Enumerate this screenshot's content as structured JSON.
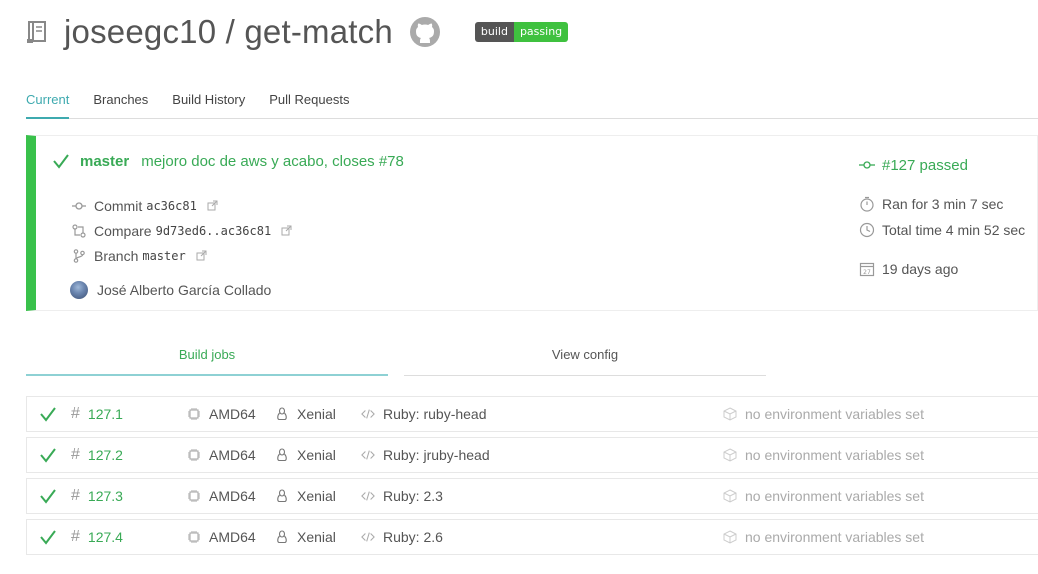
{
  "repo": {
    "owner": "joseegc10",
    "separator": " / ",
    "name": "get-match"
  },
  "badge": {
    "left": "build",
    "right": "passing"
  },
  "tabs": [
    {
      "label": "Current",
      "active": true
    },
    {
      "label": "Branches",
      "active": false
    },
    {
      "label": "Build History",
      "active": false
    },
    {
      "label": "Pull Requests",
      "active": false
    }
  ],
  "build": {
    "status": "passed",
    "branch": "master",
    "commit_message": "mejoro doc de aws y acabo, closes #78",
    "commit_label": "Commit",
    "commit_hash": "ac36c81",
    "compare_label": "Compare",
    "compare_range": "9d73ed6..ac36c81",
    "branch_label": "Branch",
    "branch_value": "master",
    "author": "José Alberto García Collado",
    "number_text": "#127 passed",
    "ran_for": "Ran for 3 min 7 sec",
    "total_time": "Total time 4 min 52 sec",
    "age": "19 days ago"
  },
  "jobs_tabs": {
    "build_jobs": "Build jobs",
    "view_config": "View config"
  },
  "jobs": [
    {
      "number": "127.1",
      "arch": "AMD64",
      "os": "Xenial",
      "language": "Ruby: ruby-head",
      "env": "no environment variables set"
    },
    {
      "number": "127.2",
      "arch": "AMD64",
      "os": "Xenial",
      "language": "Ruby: jruby-head",
      "env": "no environment variables set"
    },
    {
      "number": "127.3",
      "arch": "AMD64",
      "os": "Xenial",
      "language": "Ruby: 2.3",
      "env": "no environment variables set"
    },
    {
      "number": "127.4",
      "arch": "AMD64",
      "os": "Xenial",
      "language": "Ruby: 2.6",
      "env": "no environment variables set"
    }
  ],
  "colors": {
    "success": "#39aa56",
    "accent": "#3eaaaf",
    "bar": "#39c14b",
    "badge_pass": "#3fc13f"
  }
}
